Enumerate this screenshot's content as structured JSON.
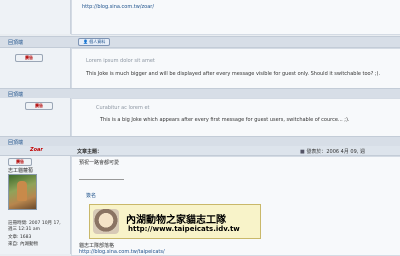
{
  "post0": {
    "url": "http://blog.sina.com.tw/zoar/",
    "footer_label": "回頂端",
    "profile_btn": "個人資料"
  },
  "post1": {
    "btn": "廣告",
    "muted": "Lorem ipsum dolor sit amet",
    "text": "This Joke is much bigger and will be displayed after every message visible for guest only. Should it switchable too? ;).",
    "footer_label": "回頂端"
  },
  "post2": {
    "btn": "廣告",
    "muted": "Curabitur ac lorem et",
    "text": "This is a big Joke which appears after every first message for guest users, switchable of cource... ;).",
    "footer_label": "回頂端"
  },
  "post3": {
    "author": "Zoar",
    "header_title": "文章主題：",
    "header_meta": "發表於：2006 4月 09, 週",
    "user_rank": "志工貓蘿蔔",
    "registered": "註冊時間: 2007 10月 17, 週三 12:31 am",
    "posts": "文章: 1683",
    "location": "來自: 內湖動物",
    "body_line1": "預祝一路會都可愛",
    "signature_label": "簽名",
    "banner_title": "內湖動物之家貓志工隊",
    "banner_url": "http://www.taipeicats.idv.tw",
    "footer_text": "貓志工隊部落格",
    "footer_url": "http://blog.sina.com.tw/taipeicats/"
  },
  "colors": {
    "accent": "#1a4f8a",
    "author": "#c00000"
  }
}
